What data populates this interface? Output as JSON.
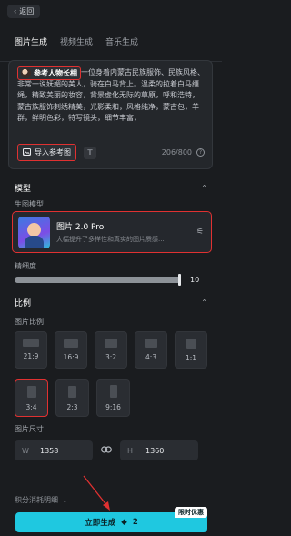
{
  "header": {
    "back_label": "返回"
  },
  "tabs": [
    {
      "label": "图片生成",
      "active": true
    },
    {
      "label": "视频生成",
      "active": false
    },
    {
      "label": "音乐生成",
      "active": false
    }
  ],
  "prompt": {
    "reference_chip": "参考人物长相",
    "text": "一位身着内蒙古民族服饰、民族风格、非常一说妩媚的美人，骑在白马背上。温柔的拉着白马缰绳，精致美丽的妆容，背景虚化无际的草原，呼和浩特，蒙古族服饰刺绣精美，光影柔和，风格纯净，蒙古包，羊群，鲜明色彩，特写镜头，细节丰富，",
    "import_label": "导入参考图",
    "t_label": "T",
    "counter": "206/800"
  },
  "model": {
    "section_title": "模型",
    "label": "生图模型",
    "name": "图片 2.0 Pro",
    "description": "大幅提升了多样性和真实的图片质感..."
  },
  "precision": {
    "label": "精细度",
    "value": 10,
    "max": 10
  },
  "ratio": {
    "section_title": "比例",
    "label": "图片比例",
    "options": [
      "21:9",
      "16:9",
      "3:2",
      "4:3",
      "1:1",
      "3:4",
      "2:3",
      "9:16"
    ],
    "selected": "3:4"
  },
  "size": {
    "label": "图片尺寸",
    "width_key": "W",
    "width": "1358",
    "height_key": "H",
    "height": "1360"
  },
  "credits": {
    "label": "积分消耗明细"
  },
  "generate": {
    "label": "立即生成",
    "cost": "2",
    "badge": "限时优惠"
  },
  "colors": {
    "accent": "#1fc8e0",
    "highlight": "#e03131"
  },
  "icons": [
    "back-icon",
    "image-icon",
    "info-icon",
    "chevron-up-icon",
    "chevron-down-icon",
    "settings-icon",
    "link-icon",
    "diamond-icon"
  ]
}
